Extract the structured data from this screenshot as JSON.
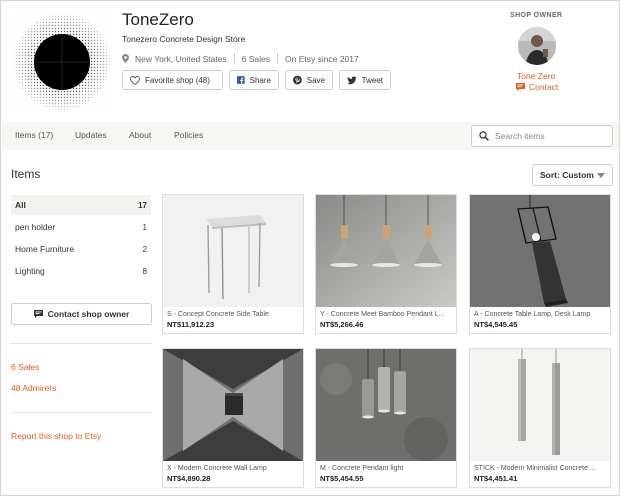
{
  "shop": {
    "name": "ToneZero",
    "tagline": "Tonezero Concrete Design Store",
    "location": "New York, United States",
    "sales": "6 Sales",
    "since": "On Etsy since 2017"
  },
  "actions": {
    "favorite": "Favorite shop (48)",
    "share": "Share",
    "save": "Save",
    "tweet": "Tweet"
  },
  "owner": {
    "label": "SHOP OWNER",
    "name": "Tone Zero",
    "contact": "Contact"
  },
  "nav": {
    "tabs": [
      "Items (17)",
      "Updates",
      "About",
      "Policies"
    ],
    "search_placeholder": "Search items"
  },
  "main": {
    "heading": "Items",
    "sort": "Sort: Custom"
  },
  "categories": [
    {
      "label": "All",
      "count": "17"
    },
    {
      "label": "pen holder",
      "count": "1"
    },
    {
      "label": "Home Furniture",
      "count": "2"
    },
    {
      "label": "Lighting",
      "count": "8"
    }
  ],
  "sidebar": {
    "contact_button": "Contact shop owner",
    "sales_link": "6 Sales",
    "admirers_link": "48 Admirers",
    "report_link": "Report this shop to Etsy"
  },
  "listings": [
    {
      "title": "S - Concept Concrete Side Table",
      "price": "NT$11,912.23"
    },
    {
      "title": "Y - Concrete Meet Bamboo Pendant L...",
      "price": "NT$5,266.46"
    },
    {
      "title": "A - Concrete Table Lamp, Desk Lamp",
      "price": "NT$4,545.45"
    },
    {
      "title": "X - Modern Concrete Wall Lamp",
      "price": "NT$4,890.28"
    },
    {
      "title": "M - Concrete Pendant light",
      "price": "NT$5,454.55"
    },
    {
      "title": "STICK - Modern Minimalist Concrete ...",
      "price": "NT$4,451.41"
    }
  ],
  "colors": {
    "accent": "#e35c1c",
    "nav_bg": "#f6f6f3"
  }
}
